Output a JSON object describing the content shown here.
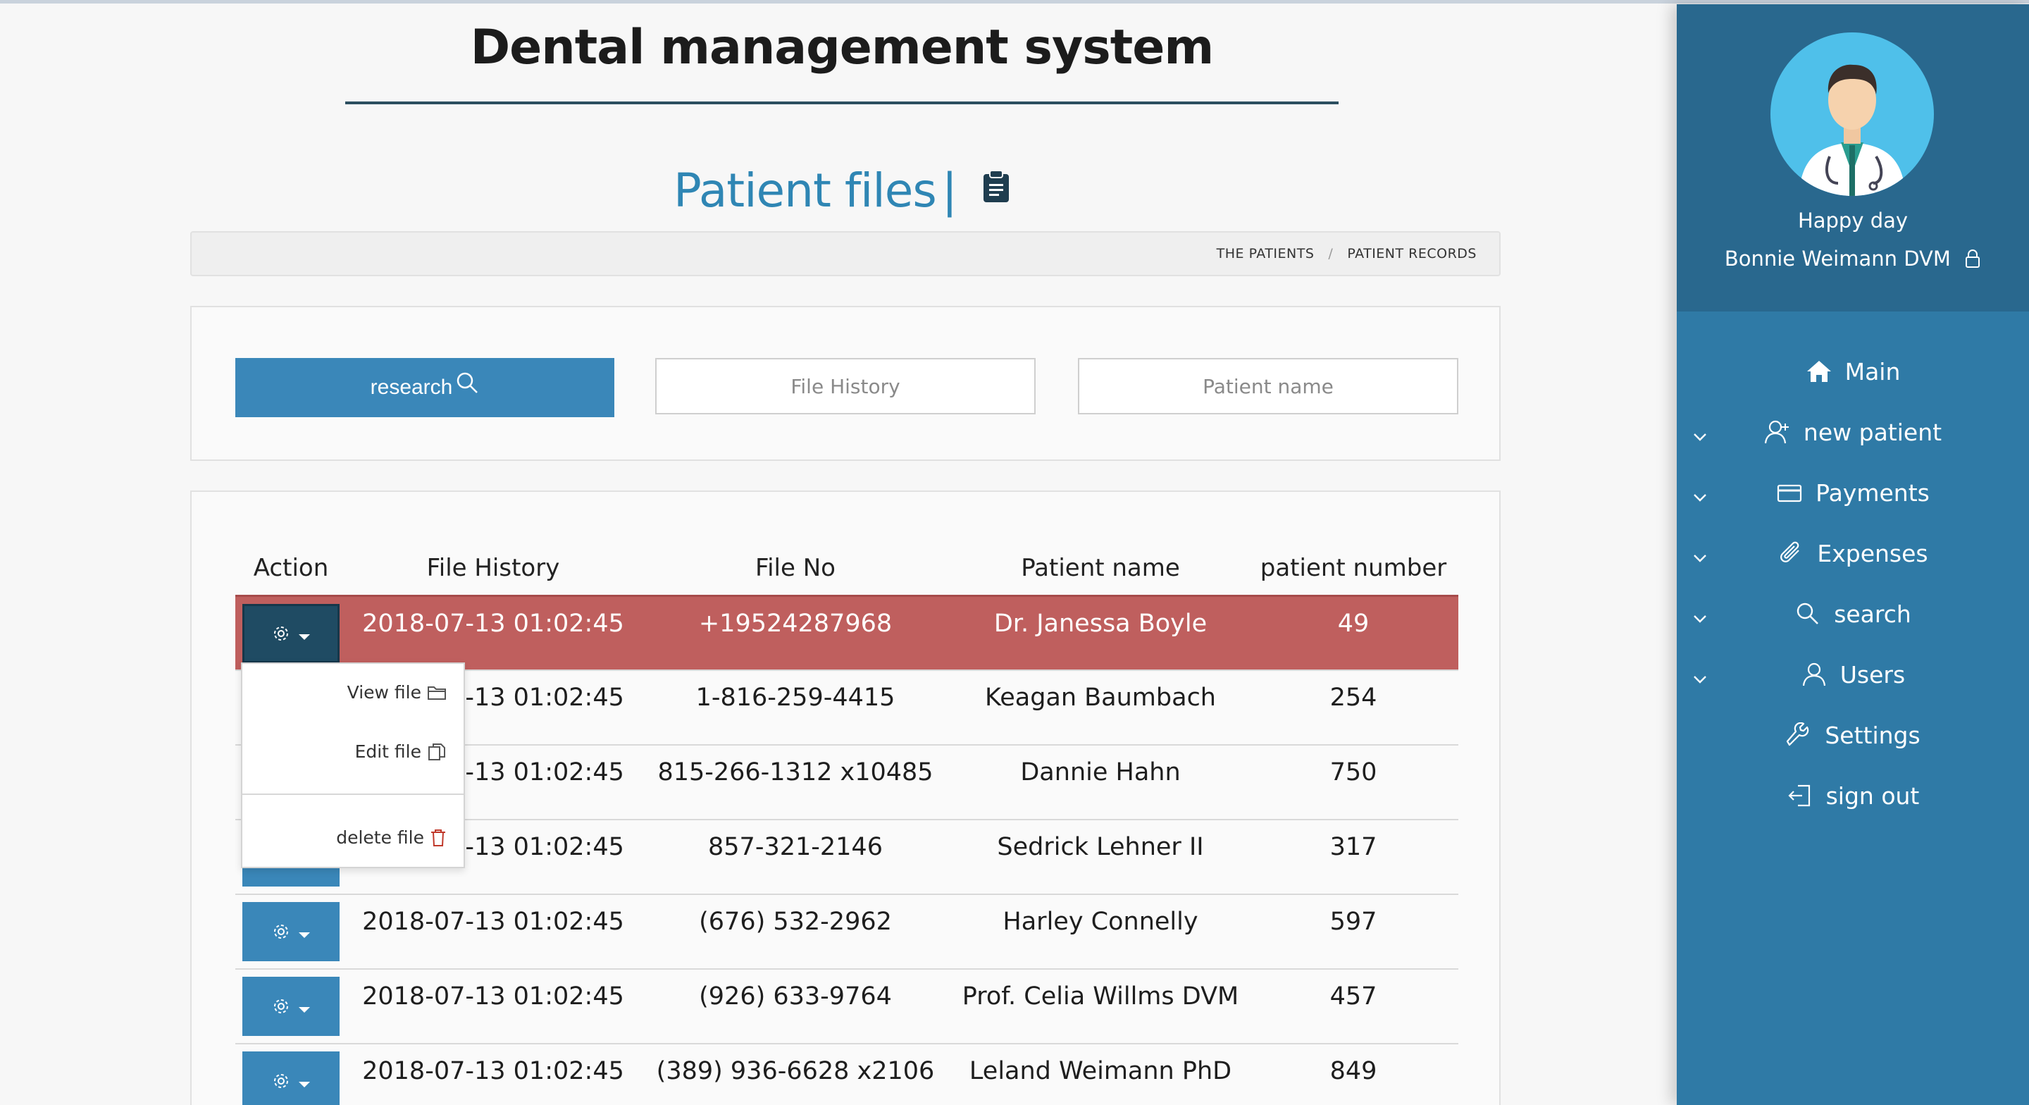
{
  "app_title": "Dental management system",
  "page": {
    "title": "Patient files",
    "separator": "|"
  },
  "breadcrumb": {
    "items": [
      "THE PATIENTS",
      "PATIENT RECORDS"
    ],
    "separator": "/"
  },
  "search": {
    "research_label": "research",
    "file_history_placeholder": "File History",
    "patient_name_placeholder": "Patient name"
  },
  "table": {
    "headers": [
      "Action",
      "File History",
      "File No",
      "Patient name",
      "patient number"
    ],
    "rows": [
      {
        "file_history": "2018-07-13 01:02:45",
        "file_no": "+19524287968",
        "patient_name": "Dr. Janessa Boyle",
        "patient_number": "49",
        "active": true
      },
      {
        "file_history": "2018-07-13 01:02:45",
        "file_no": "1-816-259-4415",
        "patient_name": "Keagan Baumbach",
        "patient_number": "254"
      },
      {
        "file_history": "2018-07-13 01:02:45",
        "file_no": "815-266-1312 x10485",
        "patient_name": "Dannie Hahn",
        "patient_number": "750"
      },
      {
        "file_history": "2018-07-13 01:02:45",
        "file_no": "857-321-2146",
        "patient_name": "Sedrick Lehner II",
        "patient_number": "317"
      },
      {
        "file_history": "2018-07-13 01:02:45",
        "file_no": "(676) 532-2962",
        "patient_name": "Harley Connelly",
        "patient_number": "597"
      },
      {
        "file_history": "2018-07-13 01:02:45",
        "file_no": "(926) 633-9764",
        "patient_name": "Prof. Celia Willms DVM",
        "patient_number": "457"
      },
      {
        "file_history": "2018-07-13 01:02:45",
        "file_no": "(389) 936-6628 x2106",
        "patient_name": "Leland Weimann PhD",
        "patient_number": "849"
      }
    ]
  },
  "action_menu": {
    "view_label": "View file",
    "edit_label": "Edit file",
    "delete_label": "delete file"
  },
  "sidebar": {
    "greeting": "Happy day",
    "user_name": "Bonnie Weimann DVM",
    "nav": [
      {
        "label": "Main",
        "icon": "home-icon",
        "expandable": false
      },
      {
        "label": "new patient",
        "icon": "user-add-icon",
        "expandable": true
      },
      {
        "label": "Payments",
        "icon": "credit-card-icon",
        "expandable": true
      },
      {
        "label": "Expenses",
        "icon": "paperclip-icon",
        "expandable": true
      },
      {
        "label": "search",
        "icon": "search-icon",
        "expandable": true
      },
      {
        "label": "Users",
        "icon": "user-icon",
        "expandable": true
      },
      {
        "label": "Settings",
        "icon": "wrench-icon",
        "expandable": false
      },
      {
        "label": "sign out",
        "icon": "sign-out-icon",
        "expandable": false
      }
    ]
  },
  "colors": {
    "accent": "#3a87b9",
    "active_row": "#bf5f5e",
    "sidebar": "#2f7aa6",
    "sidebar_header": "#29688e",
    "title_blue": "#2f86b4"
  }
}
